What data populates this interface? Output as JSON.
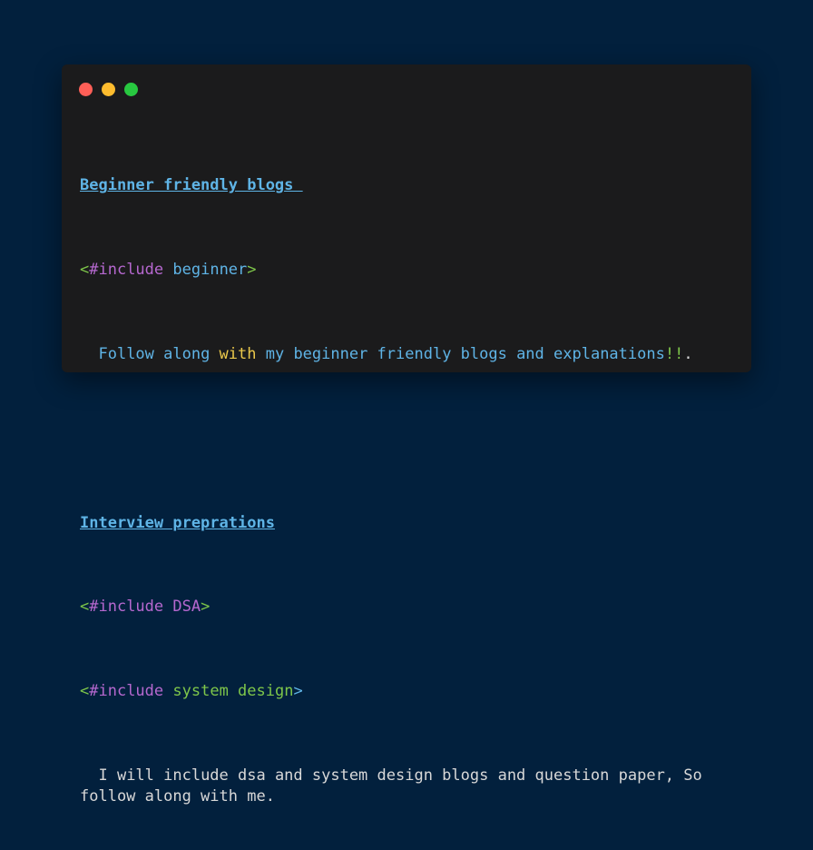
{
  "colors": {
    "background": "#02203d",
    "window": "#1b1b1c",
    "dot_red": "#ff5f57",
    "dot_yellow": "#febc2e",
    "dot_green": "#28c840"
  },
  "section1": {
    "heading": "Beginner friendly blogs ",
    "include": {
      "open": "<",
      "directive": "#include",
      "space": " ",
      "target": "beginner",
      "close": ">"
    },
    "description": {
      "indent": "  ",
      "part1": "Follow along ",
      "keyword": "with",
      "part2": " my beginner friendly blogs and explanations",
      "bangs": "!!",
      "end": "."
    }
  },
  "section2": {
    "heading": "Interview preprations",
    "include1": {
      "open": "<",
      "directive": "#include",
      "space": " ",
      "target": "DSA",
      "close": ">"
    },
    "include2": {
      "open": "<",
      "directive": "#include",
      "space": " ",
      "target": "system design",
      "close": ">"
    },
    "description": "  I will include dsa and system design blogs and question paper, So follow along with me."
  }
}
